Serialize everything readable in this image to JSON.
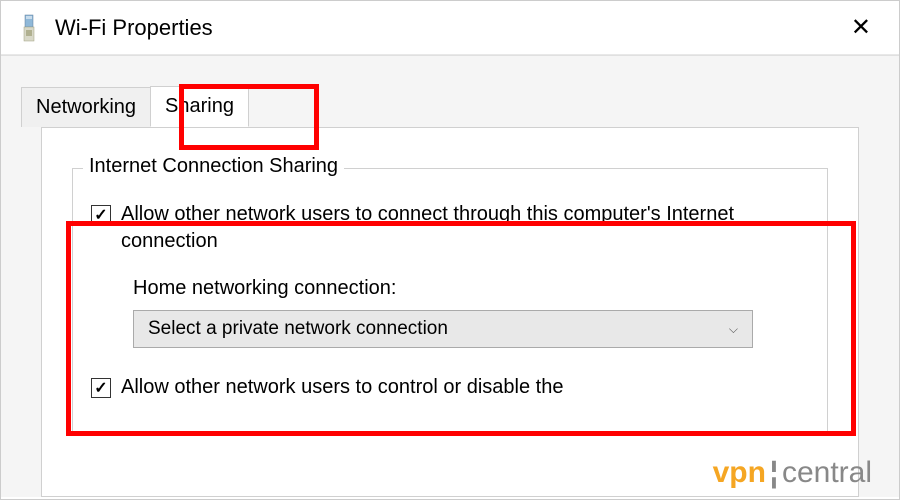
{
  "window": {
    "title": "Wi-Fi Properties"
  },
  "tabs": {
    "networking": "Networking",
    "sharing": "Sharing"
  },
  "groupbox": {
    "title": "Internet Connection Sharing"
  },
  "checkboxes": {
    "allow_connect": {
      "label": "Allow other network users to connect through this computer's Internet connection",
      "checked": true
    },
    "allow_control": {
      "label": "Allow other network users to control or disable the",
      "checked": true
    }
  },
  "home_networking": {
    "label": "Home networking connection:",
    "dropdown_value": "Select a private network connection"
  },
  "watermark": {
    "part1": "vpn",
    "part2": "central"
  },
  "highlights": {
    "sharing_tab": true,
    "main_section": true
  }
}
